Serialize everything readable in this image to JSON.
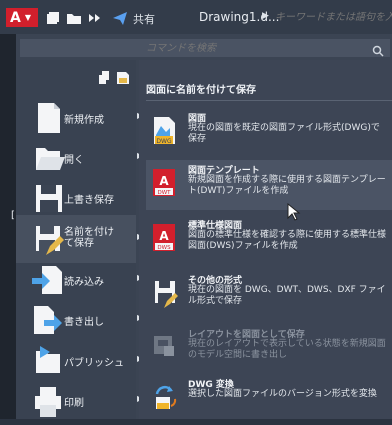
{
  "titlebar": {
    "app_letter": "A",
    "share_label": "共有",
    "document_title": "Drawing1.d...",
    "keyword_search_placeholder": "キーワードまたは語句を入力"
  },
  "menu_search": {
    "placeholder": "コマンドを検索"
  },
  "left_menu": [
    {
      "label": "新規作成",
      "icon": "new-drawing-icon",
      "has_arrow": true
    },
    {
      "label": "開く",
      "icon": "open-folder-icon",
      "has_arrow": true
    },
    {
      "label": "上書き保存",
      "icon": "save-icon",
      "has_arrow": false
    },
    {
      "label_line1": "名前を付け",
      "label_line2": "て保存",
      "icon": "save-as-icon",
      "has_arrow": true,
      "selected": true
    },
    {
      "label": "読み込み",
      "icon": "import-icon",
      "has_arrow": true
    },
    {
      "label": "書き出し",
      "icon": "export-icon",
      "has_arrow": true
    },
    {
      "label": "パブリッシュ",
      "icon": "publish-icon",
      "has_arrow": true
    },
    {
      "label": "印刷",
      "icon": "print-icon",
      "has_arrow": true
    }
  ],
  "right_panel": {
    "title": "図面に名前を付けて保存",
    "items": [
      {
        "title": "図面",
        "desc": "現在の図面を既定の図面ファイル形式(DWG)で保存",
        "icon": "dwg-file-icon"
      },
      {
        "title": "図面テンプレート",
        "desc": "新規図面を作成する際に使用する図面テンプレート(DWT)ファイルを作成",
        "icon": "dwt-template-icon",
        "highlighted": true
      },
      {
        "title": "標準仕様図面",
        "desc": "図面の標準仕様を確認する際に使用する標準仕様図面(DWS)ファイルを作成",
        "icon": "dws-standards-icon"
      },
      {
        "title": "その他の形式",
        "desc": "現在の図面を DWG、DWT、DWS、DXF ファイル形式で保存",
        "icon": "other-formats-icon"
      },
      {
        "title": "レイアウトを図面として保存",
        "desc": "現在のレイアウトで表示している状態を新規図面のモデル空間に書き出し",
        "icon": "save-layout-icon",
        "disabled": true
      },
      {
        "title": "DWG 変換",
        "desc": "選択した図面ファイルのバージョン形式を変換",
        "icon": "dwg-convert-icon"
      }
    ]
  },
  "colors": {
    "accent_red": "#d21f2c",
    "menu_bg": "#3b4453",
    "highlight": "#4b5465"
  }
}
